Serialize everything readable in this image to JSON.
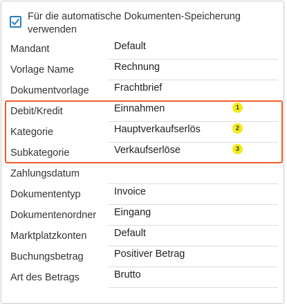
{
  "header": {
    "checkbox_checked": true,
    "text": "Für die automatische Dokumenten-Speicherung verwenden"
  },
  "fields": [
    {
      "label": "Mandant",
      "value": "Default",
      "badge": ""
    },
    {
      "label": "Vorlage Name",
      "value": "Rechnung",
      "badge": ""
    },
    {
      "label": "Dokumentvorlage",
      "value": "Frachtbrief",
      "badge": ""
    },
    {
      "label": "Debit/Kredit",
      "value": "Einnahmen",
      "badge": "1"
    },
    {
      "label": "Kategorie",
      "value": "Hauptverkaufserlös",
      "badge": "2"
    },
    {
      "label": "Subkategorie",
      "value": "Verkaufserlöse",
      "badge": "3"
    },
    {
      "label": "Zahlungsdatum",
      "value": "",
      "badge": ""
    },
    {
      "label": "Dokumententyp",
      "value": "Invoice",
      "badge": ""
    },
    {
      "label": "Dokumentenordner",
      "value": "Eingang",
      "badge": ""
    },
    {
      "label": "Marktplatzkonten",
      "value": "Default",
      "badge": ""
    },
    {
      "label": "Buchungsbetrag",
      "value": "Positiver Betrag",
      "badge": ""
    },
    {
      "label": "Art des Betrags",
      "value": "Brutto",
      "badge": ""
    }
  ],
  "colors": {
    "accent": "#2a7fbd",
    "highlight_border": "#f25a2a",
    "badge_fill": "#f2ea1a"
  }
}
